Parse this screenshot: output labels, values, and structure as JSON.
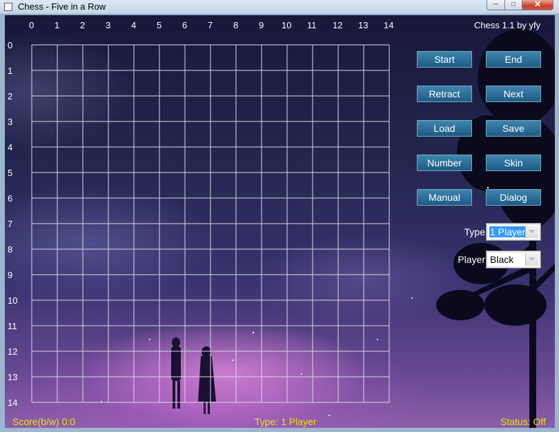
{
  "window": {
    "title": "Chess - Five in a Row",
    "controls": {
      "minimize": "─",
      "maximize": "□",
      "close": "✕"
    }
  },
  "board": {
    "size": 15,
    "line_color": "#d8d8e8",
    "col_labels": [
      "0",
      "1",
      "2",
      "3",
      "4",
      "5",
      "6",
      "7",
      "8",
      "9",
      "10",
      "11",
      "12",
      "13",
      "14"
    ],
    "row_labels": [
      "0",
      "1",
      "2",
      "3",
      "4",
      "5",
      "6",
      "7",
      "8",
      "9",
      "10",
      "11",
      "12",
      "13",
      "14"
    ]
  },
  "header": {
    "version": "Chess 1.1 by yfy"
  },
  "buttons": {
    "start": "Start",
    "end": "End",
    "retract": "Retract",
    "next": "Next",
    "load": "Load",
    "save": "Save",
    "number": "Number",
    "skin": "Skin",
    "manual": "Manual",
    "dialog": "Dialog"
  },
  "settings": {
    "type_label": "Type",
    "type_value": "1 Player",
    "player_label": "Player",
    "player_value": "Black"
  },
  "status_bar": {
    "score": "Score(b/w) 0:0",
    "type": "Type: 1 Player",
    "status": "Status: Off",
    "color": "#f0e000"
  }
}
